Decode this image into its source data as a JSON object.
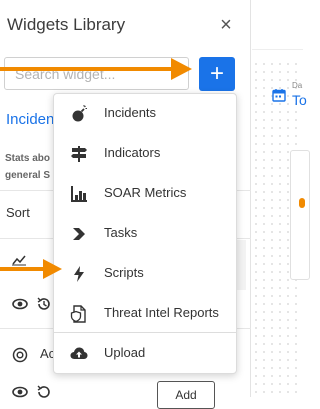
{
  "panel": {
    "title": "Widgets Library",
    "close_icon": "×",
    "search_placeholder": "Search widget...",
    "add_label": "+",
    "category_label": "Inciden",
    "desc_line1": "Stats abo",
    "desc_line2": "general S",
    "sort_label": "Sort",
    "acc_text": "Ac",
    "add_small_label": "Add"
  },
  "dashboard": {
    "date_label": "Da",
    "date_value": "To"
  },
  "menu": {
    "items": [
      {
        "label": "Incidents",
        "icon": "bomb-icon"
      },
      {
        "label": "Indicators",
        "icon": "signpost-icon"
      },
      {
        "label": "SOAR Metrics",
        "icon": "bar-chart-icon"
      },
      {
        "label": "Tasks",
        "icon": "chevron-right-icon"
      },
      {
        "label": "Scripts",
        "icon": "bolt-icon"
      },
      {
        "label": "Threat Intel Reports",
        "icon": "report-icon"
      }
    ],
    "upload_label": "Upload",
    "upload_icon": "cloud-upload-icon"
  },
  "colors": {
    "accent": "#1a73e8",
    "annotation_arrow": "#f18a00"
  }
}
